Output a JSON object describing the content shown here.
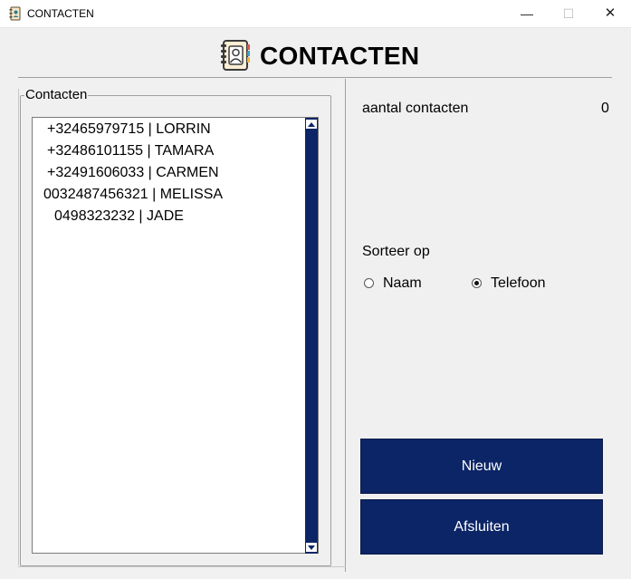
{
  "window": {
    "title": "CONTACTEN",
    "minimize_glyph": "—",
    "maximize_glyph": "☐",
    "close_glyph": "✕"
  },
  "header": {
    "title": "CONTACTEN",
    "icon": "address-book-icon"
  },
  "contacts_group": {
    "label": "Contacten",
    "items": [
      "+32465979715 | LORRIN",
      "+32486101155 | TAMARA",
      "+32491606033 | CARMEN",
      "0032487456321 | MELISSA",
      "0498323232 | JADE"
    ]
  },
  "stats": {
    "count_label": "aantal contacten",
    "count_value": "0"
  },
  "sort": {
    "label": "Sorteer op",
    "options": [
      {
        "label": "Naam",
        "checked": false
      },
      {
        "label": "Telefoon",
        "checked": true
      }
    ]
  },
  "buttons": {
    "new_label": "Nieuw",
    "close_label": "Afsluiten"
  },
  "colors": {
    "accent": "#0b2566",
    "background": "#f0f0f0"
  }
}
